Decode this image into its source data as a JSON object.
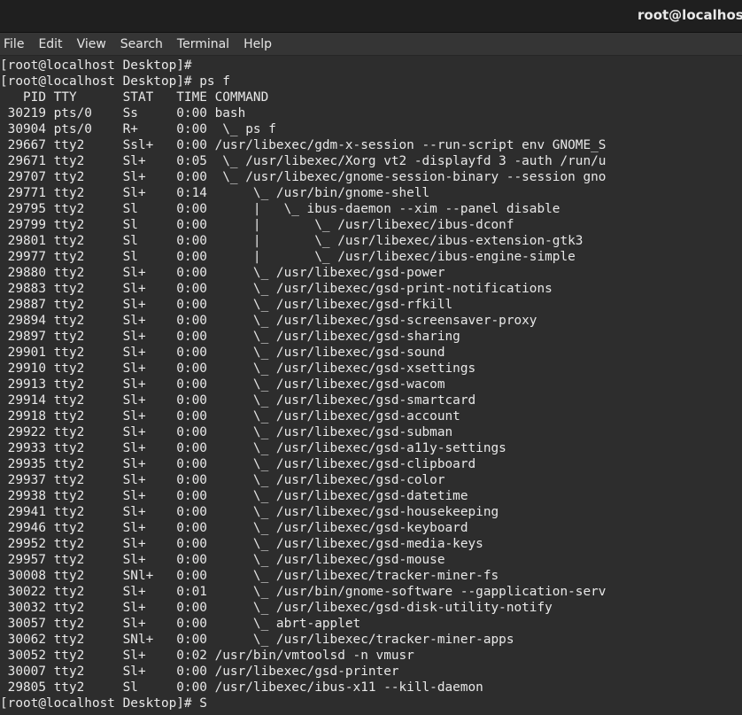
{
  "window": {
    "title": "root@localhost:~/Desktop"
  },
  "menubar": {
    "items": [
      "File",
      "Edit",
      "View",
      "Search",
      "Terminal",
      "Help"
    ]
  },
  "terminal": {
    "lines": [
      "[root@localhost Desktop]#",
      "[root@localhost Desktop]# ps f",
      "   PID TTY      STAT   TIME COMMAND",
      " 30219 pts/0    Ss     0:00 bash",
      " 30904 pts/0    R+     0:00  \\_ ps f",
      " 29667 tty2     Ssl+   0:00 /usr/libexec/gdm-x-session --run-script env GNOME_S",
      " 29671 tty2     Sl+    0:05  \\_ /usr/libexec/Xorg vt2 -displayfd 3 -auth /run/u",
      " 29707 tty2     Sl+    0:00  \\_ /usr/libexec/gnome-session-binary --session gno",
      " 29771 tty2     Sl+    0:14      \\_ /usr/bin/gnome-shell",
      " 29795 tty2     Sl     0:00      |   \\_ ibus-daemon --xim --panel disable",
      " 29799 tty2     Sl     0:00      |       \\_ /usr/libexec/ibus-dconf",
      " 29801 tty2     Sl     0:00      |       \\_ /usr/libexec/ibus-extension-gtk3",
      " 29977 tty2     Sl     0:00      |       \\_ /usr/libexec/ibus-engine-simple",
      " 29880 tty2     Sl+    0:00      \\_ /usr/libexec/gsd-power",
      " 29883 tty2     Sl+    0:00      \\_ /usr/libexec/gsd-print-notifications",
      " 29887 tty2     Sl+    0:00      \\_ /usr/libexec/gsd-rfkill",
      " 29894 tty2     Sl+    0:00      \\_ /usr/libexec/gsd-screensaver-proxy",
      " 29897 tty2     Sl+    0:00      \\_ /usr/libexec/gsd-sharing",
      " 29901 tty2     Sl+    0:00      \\_ /usr/libexec/gsd-sound",
      " 29910 tty2     Sl+    0:00      \\_ /usr/libexec/gsd-xsettings",
      " 29913 tty2     Sl+    0:00      \\_ /usr/libexec/gsd-wacom",
      " 29914 tty2     Sl+    0:00      \\_ /usr/libexec/gsd-smartcard",
      " 29918 tty2     Sl+    0:00      \\_ /usr/libexec/gsd-account",
      " 29922 tty2     Sl+    0:00      \\_ /usr/libexec/gsd-subman",
      " 29933 tty2     Sl+    0:00      \\_ /usr/libexec/gsd-a11y-settings",
      " 29935 tty2     Sl+    0:00      \\_ /usr/libexec/gsd-clipboard",
      " 29937 tty2     Sl+    0:00      \\_ /usr/libexec/gsd-color",
      " 29938 tty2     Sl+    0:00      \\_ /usr/libexec/gsd-datetime",
      " 29941 tty2     Sl+    0:00      \\_ /usr/libexec/gsd-housekeeping",
      " 29946 tty2     Sl+    0:00      \\_ /usr/libexec/gsd-keyboard",
      " 29952 tty2     Sl+    0:00      \\_ /usr/libexec/gsd-media-keys",
      " 29957 tty2     Sl+    0:00      \\_ /usr/libexec/gsd-mouse",
      " 30008 tty2     SNl+   0:00      \\_ /usr/libexec/tracker-miner-fs",
      " 30022 tty2     Sl+    0:01      \\_ /usr/bin/gnome-software --gapplication-serv",
      " 30032 tty2     Sl+    0:00      \\_ /usr/libexec/gsd-disk-utility-notify",
      " 30057 tty2     Sl+    0:00      \\_ abrt-applet",
      " 30062 tty2     SNl+   0:00      \\_ /usr/libexec/tracker-miner-apps",
      " 30052 tty2     Sl+    0:02 /usr/bin/vmtoolsd -n vmusr",
      " 30007 tty2     Sl+    0:00 /usr/libexec/gsd-printer",
      " 29805 tty2     Sl     0:00 /usr/libexec/ibus-x11 --kill-daemon"
    ],
    "prompt": "[root@localhost Desktop]# ",
    "input": "S"
  }
}
